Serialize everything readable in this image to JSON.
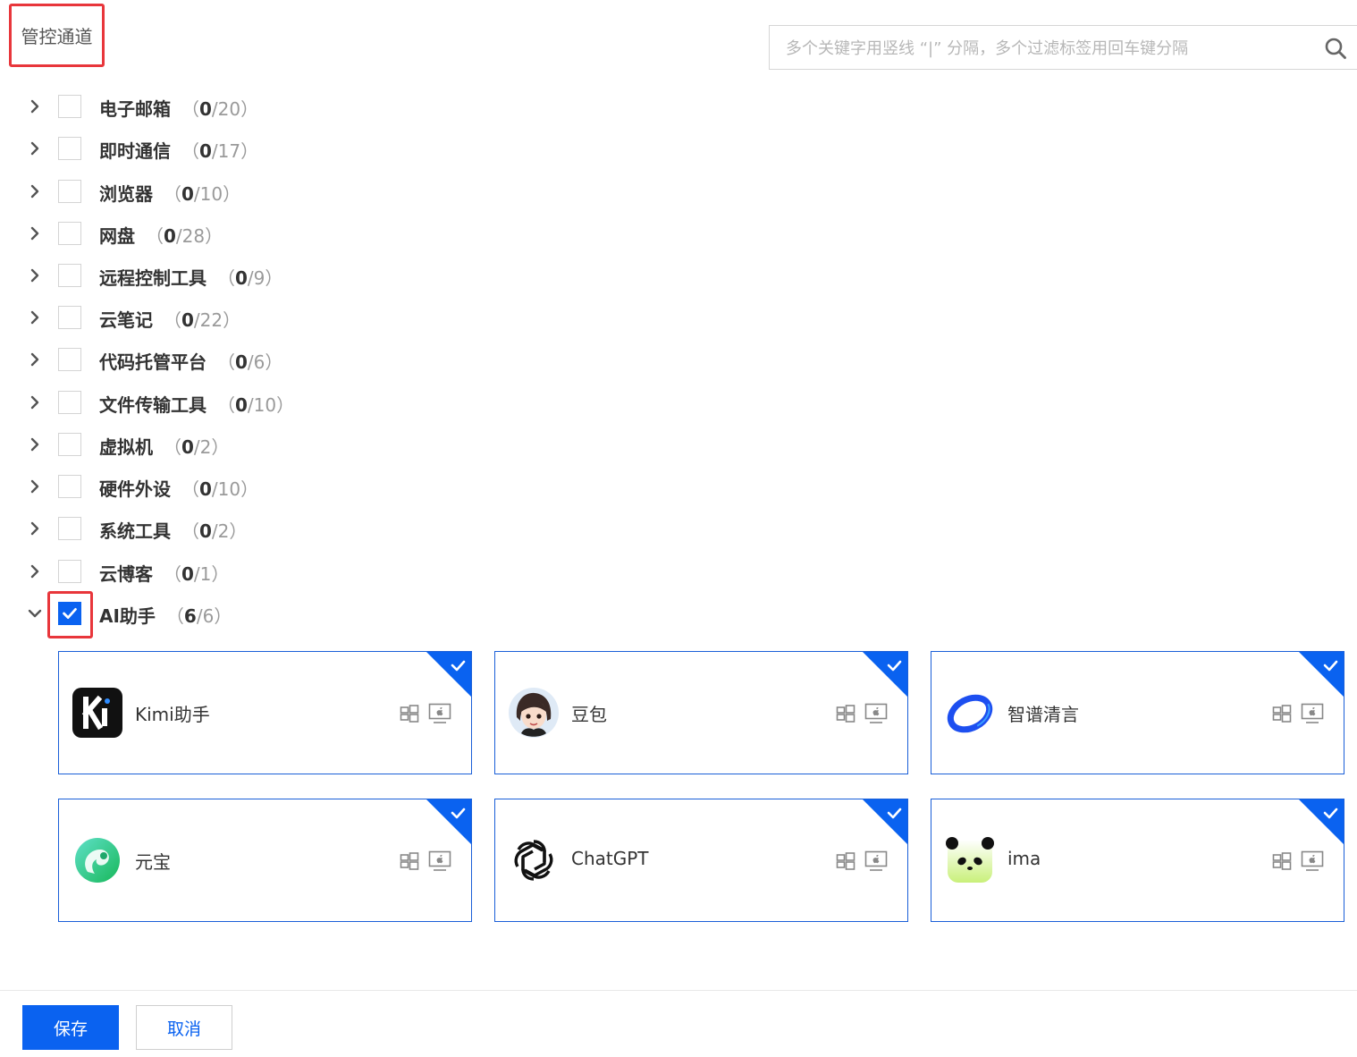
{
  "header": {
    "title": "管控通道",
    "search_placeholder": "多个关键字用竖线 “|” 分隔，多个过滤标签用回车键分隔"
  },
  "categories": [
    {
      "label": "电子邮箱",
      "selected": "0",
      "total": "/20",
      "expanded": false,
      "checked": false
    },
    {
      "label": "即时通信",
      "selected": "0",
      "total": "/17",
      "expanded": false,
      "checked": false
    },
    {
      "label": "浏览器",
      "selected": "0",
      "total": "/10",
      "expanded": false,
      "checked": false
    },
    {
      "label": "网盘",
      "selected": "0",
      "total": "/28",
      "expanded": false,
      "checked": false
    },
    {
      "label": "远程控制工具",
      "selected": "0",
      "total": "/9",
      "expanded": false,
      "checked": false
    },
    {
      "label": "云笔记",
      "selected": "0",
      "total": "/22",
      "expanded": false,
      "checked": false
    },
    {
      "label": "代码托管平台",
      "selected": "0",
      "total": "/6",
      "expanded": false,
      "checked": false
    },
    {
      "label": "文件传输工具",
      "selected": "0",
      "total": "/10",
      "expanded": false,
      "checked": false
    },
    {
      "label": "虚拟机",
      "selected": "0",
      "total": "/2",
      "expanded": false,
      "checked": false
    },
    {
      "label": "硬件外设",
      "selected": "0",
      "total": "/10",
      "expanded": false,
      "checked": false
    },
    {
      "label": "系统工具",
      "selected": "0",
      "total": "/2",
      "expanded": false,
      "checked": false
    },
    {
      "label": "云博客",
      "selected": "0",
      "total": "/1",
      "expanded": false,
      "checked": false
    },
    {
      "label": "AI助手",
      "selected": "6",
      "total": "/6",
      "expanded": true,
      "checked": true
    }
  ],
  "count_parens": {
    "open": "（",
    "close": "）"
  },
  "ai_apps": [
    {
      "name": "Kimi助手",
      "icon": "kimi-logo-icon",
      "selected": true
    },
    {
      "name": "豆包",
      "icon": "doubao-avatar-icon",
      "selected": true
    },
    {
      "name": "智谱清言",
      "icon": "zhipu-logo-icon",
      "selected": true
    },
    {
      "name": "元宝",
      "icon": "yuanbao-logo-icon",
      "selected": true
    },
    {
      "name": "ChatGPT",
      "icon": "chatgpt-logo-icon",
      "selected": true
    },
    {
      "name": "ima",
      "icon": "ima-panda-icon",
      "selected": true
    }
  ],
  "footer": {
    "save_label": "保存",
    "cancel_label": "取消"
  },
  "colors": {
    "primary": "#0a62f0",
    "highlight": "#e8363b",
    "card_border": "#1a5fd8"
  }
}
